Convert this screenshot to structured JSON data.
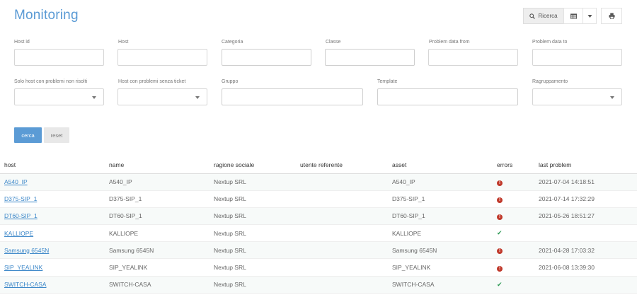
{
  "title": "Monitoring",
  "toolbar": {
    "search_label": "Ricerca",
    "icons": [
      "search-icon",
      "table-view-icon",
      "caret-down-icon",
      "print-icon"
    ]
  },
  "filters": {
    "host_id": "Host id",
    "host": "Host",
    "categoria": "Categoria",
    "classe": "Classe",
    "problem_from": "Problem data from",
    "problem_to": "Problem data to",
    "solo_host": "Solo host con problemi non risolti",
    "host_senza_ticket": "Host con problemi senza ticket",
    "gruppo": "Gruppo",
    "template": "Template",
    "raggruppamento": "Ragruppamento"
  },
  "buttons": {
    "cerca": "cerca",
    "reset": "reset"
  },
  "table": {
    "headers": [
      "host",
      "name",
      "ragione sociale",
      "utente referente",
      "asset",
      "errors",
      "last problem"
    ],
    "rows": [
      {
        "host": "A540_IP",
        "name": "A540_IP",
        "ragione": "Nextup SRL",
        "utente": "",
        "asset": "A540_IP",
        "status": "error",
        "last": "2021-07-04 14:18:51"
      },
      {
        "host": "D375-SIP_1",
        "name": "D375-SIP_1",
        "ragione": "Nextup SRL",
        "utente": "",
        "asset": "D375-SIP_1",
        "status": "error",
        "last": "2021-07-14 17:32:29"
      },
      {
        "host": "DT60-SIP_1",
        "name": "DT60-SIP_1",
        "ragione": "Nextup SRL",
        "utente": "",
        "asset": "DT60-SIP_1",
        "status": "error",
        "last": "2021-05-26 18:51:27"
      },
      {
        "host": "KALLIOPE",
        "name": "KALLIOPE",
        "ragione": "Nextup SRL",
        "utente": "",
        "asset": "KALLIOPE",
        "status": "ok",
        "last": ""
      },
      {
        "host": "Samsung 6545N",
        "name": "Samsung 6545N",
        "ragione": "Nextup SRL",
        "utente": "",
        "asset": "Samsung 6545N",
        "status": "error",
        "last": "2021-04-28 17:03:32"
      },
      {
        "host": "SIP_YEALINK",
        "name": "SIP_YEALINK",
        "ragione": "Nextup SRL",
        "utente": "",
        "asset": "SIP_YEALINK",
        "status": "error",
        "last": "2021-06-08 13:39:30"
      },
      {
        "host": "SWITCH-CASA",
        "name": "SWITCH-CASA",
        "ragione": "Nextup SRL",
        "utente": "",
        "asset": "SWITCH-CASA",
        "status": "ok",
        "last": ""
      }
    ]
  },
  "colors": {
    "accent": "#5b9bd5",
    "link": "#3a86c8",
    "error": "#c0392b",
    "ok": "#2e9a55"
  }
}
